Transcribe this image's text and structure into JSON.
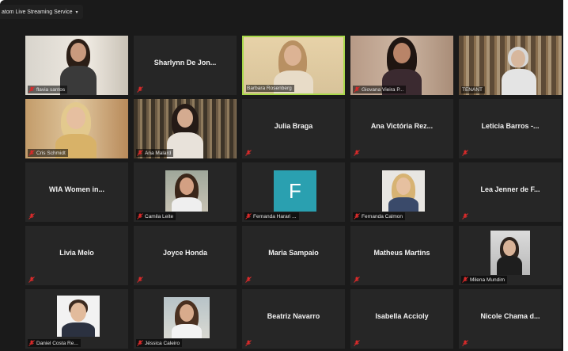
{
  "stream": {
    "label": "atom Live Streaming Service",
    "caret": "▾"
  },
  "colors": {
    "active_speaker_border": "#a8d84a",
    "tile_background": "#262626",
    "muted_icon": "#d92a2a"
  },
  "icons": {
    "muted": "mic-muted-icon"
  },
  "participants": {
    "flavia": {
      "name": "flavia santos",
      "type": "video",
      "muted": true
    },
    "sharlynn": {
      "name": "Sharlynn De Jon...",
      "type": "name",
      "muted": true
    },
    "barbara": {
      "name": "Barbara Rosenberg",
      "type": "video",
      "muted": false,
      "active_speaker": true
    },
    "giovana": {
      "name": "Giovana Vieira P...",
      "type": "video",
      "muted": true
    },
    "tenant": {
      "name": "TENANT",
      "type": "video",
      "muted": false
    },
    "cris": {
      "name": "Cris Schmidt",
      "type": "video",
      "muted": true
    },
    "ana_malard": {
      "name": "Ana Malard",
      "type": "video",
      "muted": true
    },
    "julia": {
      "name": "Julia Braga",
      "type": "name",
      "muted": true
    },
    "ana_victoria": {
      "name": "Ana Victória Rez...",
      "type": "name",
      "muted": true
    },
    "leticia": {
      "name": "Leticia Barros -...",
      "type": "name",
      "muted": true
    },
    "wia": {
      "name": "WIA Women in...",
      "type": "name",
      "muted": true
    },
    "camila": {
      "name": "Camila Leite",
      "type": "photo",
      "muted": true
    },
    "fernanda_harari": {
      "name": "Fernanda Harari ...",
      "type": "initial",
      "initial": "F",
      "muted": true
    },
    "fernanda_calmon": {
      "name": "Fernanda Calmon",
      "type": "photo",
      "muted": true
    },
    "lea": {
      "name": "Lea Jenner de F...",
      "type": "name",
      "muted": true
    },
    "livia": {
      "name": "Livia Melo",
      "type": "name",
      "muted": true
    },
    "joyce": {
      "name": "Joyce Honda",
      "type": "name",
      "muted": true
    },
    "maria": {
      "name": "Maria Sampaio",
      "type": "name",
      "muted": true
    },
    "matheus": {
      "name": "Matheus Martins",
      "type": "name",
      "muted": true
    },
    "milena": {
      "name": "Milena Mundim",
      "type": "photo",
      "muted": true
    },
    "daniel": {
      "name": "Daniel Costa Re...",
      "type": "photo",
      "muted": true
    },
    "jessica": {
      "name": "Jéssica Caleiro",
      "type": "photo",
      "muted": true
    },
    "beatriz": {
      "name": "Beatriz Navarro",
      "type": "name",
      "muted": true
    },
    "isabella": {
      "name": "Isabella Accioly",
      "type": "name",
      "muted": true
    },
    "nicole": {
      "name": "Nicole Chama d...",
      "type": "name",
      "muted": true
    }
  }
}
